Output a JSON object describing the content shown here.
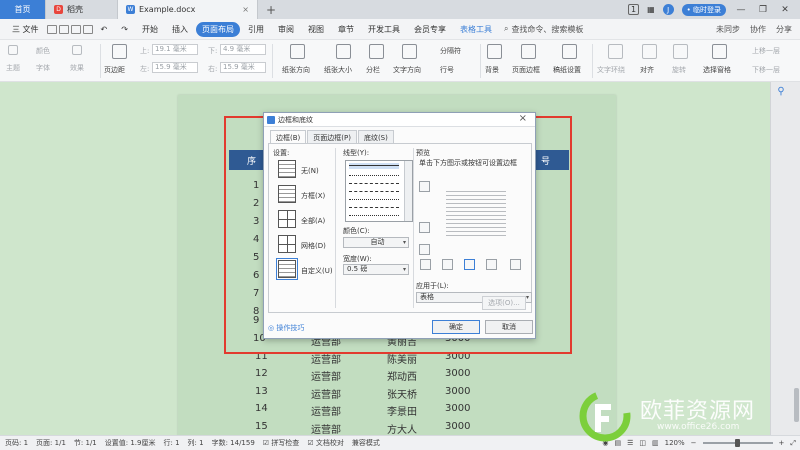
{
  "titlebar": {
    "home_tab": "首页",
    "daoke_tab": "稻壳",
    "doc_tab": "Example.docx",
    "new_tab": "+",
    "page_count": "1",
    "login_label": "• 临时登录",
    "avatar_letter": "J"
  },
  "menubar": {
    "file_label": "三 文件",
    "items": [
      "开始",
      "插入",
      "页面布局",
      "引用",
      "审阅",
      "视图",
      "章节",
      "开发工具",
      "会员专享"
    ],
    "context_tab": "表格工具",
    "search_placeholder": "查找命令、搜索模板",
    "right": [
      "未同步",
      "协作",
      "分享"
    ]
  },
  "ribbon": {
    "theme": "主题",
    "font": "字体",
    "color": "颜色",
    "effect": "效果",
    "margins": "页边距",
    "top_label": "上:",
    "top_val": "19.1 毫米",
    "bottom_label": "下:",
    "bottom_val": "4.9 毫米",
    "left_label": "左:",
    "left_val": "15.9 毫米",
    "right_label": "右:",
    "right_val": "15.9 毫米",
    "orientation": "纸张方向",
    "size": "纸张大小",
    "columns": "分栏",
    "text_dir": "文字方向",
    "line_num": "行号",
    "breaks": "分隔符",
    "background": "背景",
    "page_border": "页面边框",
    "manuscript": "稿纸设置",
    "wrap": "文字环绕",
    "align": "对齐",
    "rotate": "旋转",
    "select_pane": "选择窗格",
    "up_layer": "上移一层",
    "down_layer": "下移一层"
  },
  "table": {
    "header_left": "序",
    "header_right": "号",
    "left_numbers": [
      "1",
      "2",
      "3",
      "4",
      "5",
      "6",
      "7",
      "8",
      "9"
    ],
    "rows": [
      {
        "no": "10",
        "dept": "运营部",
        "name": "黄丽吉",
        "salary": "3000"
      },
      {
        "no": "11",
        "dept": "运营部",
        "name": "陈美丽",
        "salary": "3000"
      },
      {
        "no": "12",
        "dept": "运营部",
        "name": "郑动西",
        "salary": "3000"
      },
      {
        "no": "13",
        "dept": "运营部",
        "name": "张天桥",
        "salary": "3000"
      },
      {
        "no": "14",
        "dept": "运营部",
        "name": "李景田",
        "salary": "3000"
      },
      {
        "no": "15",
        "dept": "运营部",
        "name": "方大人",
        "salary": "3000"
      }
    ]
  },
  "dialog": {
    "title": "边框和底纹",
    "tabs": [
      "边框(B)",
      "页面边框(P)",
      "底纹(S)"
    ],
    "settings_label": "设置:",
    "settings": [
      "无(N)",
      "方框(X)",
      "全部(A)",
      "网格(D)",
      "自定义(U)"
    ],
    "line_type_label": "线型(Y):",
    "color_label": "颜色(C):",
    "color_value": "自动",
    "width_label": "宽度(W):",
    "width_value": "0.5 磅",
    "preview_label": "预览",
    "preview_hint": "单击下方图示或按钮可设置边框",
    "apply_label": "应用于(L):",
    "apply_value": "表格",
    "options_btn": "选项(O)...",
    "ok_btn": "确定",
    "cancel_btn": "取消",
    "tips": "操作技巧"
  },
  "statusbar": {
    "page_num": "页码: 1",
    "pages": "页面: 1/1",
    "section": "节: 1/1",
    "setting": "设置值: 1.9厘米",
    "row": "行: 1",
    "col": "列: 1",
    "words": "字数: 14/159",
    "spell": "拼写检查",
    "proof": "文档校对",
    "compat": "兼容模式",
    "zoom": "120%",
    "zoom_level": 0.5
  },
  "watermark": {
    "cn": "欧菲资源网",
    "url": "www.office26.com"
  },
  "colors": {
    "accent": "#3c7fd6",
    "header_fill": "#2f5a93",
    "highlight_box": "#e23a2e",
    "workspace": "#cfe6cc"
  }
}
